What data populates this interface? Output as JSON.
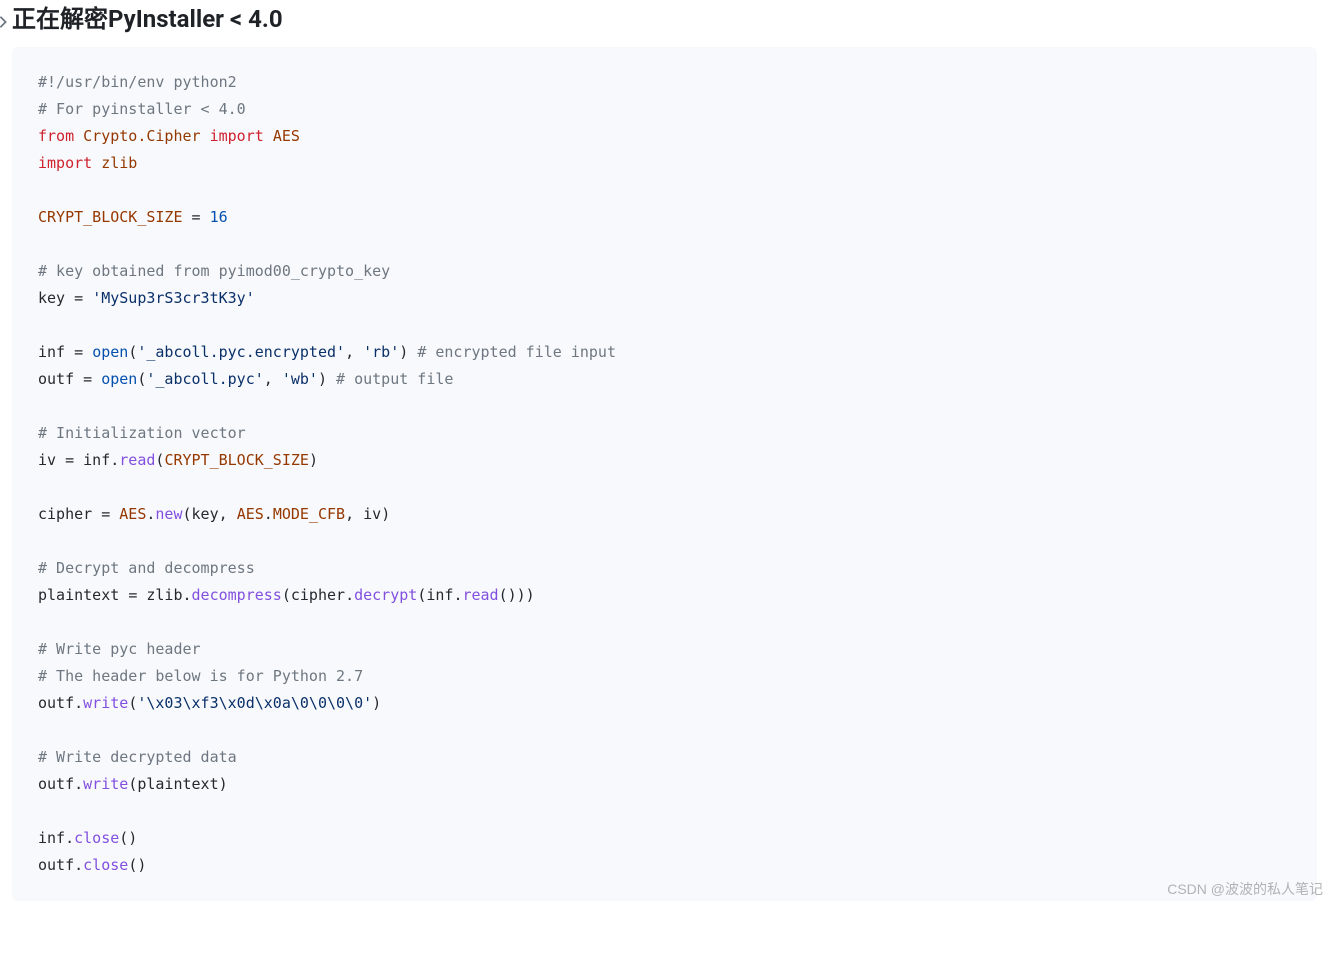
{
  "heading": "正在解密PyInstaller < 4.0",
  "watermark": "CSDN @波波的私人笔记",
  "code": {
    "l1": "#!/usr/bin/env python2",
    "l2": "# For pyinstaller < 4.0",
    "l3a": "from",
    "l3b": "Crypto.Cipher",
    "l3c": "import",
    "l3d": "AES",
    "l4a": "import",
    "l4b": "zlib",
    "l6a": "CRYPT_BLOCK_SIZE",
    "l6b": "=",
    "l6c": "16",
    "l8": "# key obtained from pyimod00_crypto_key",
    "l9a": "key",
    "l9b": "=",
    "l9c": "'MySup3rS3cr3tK3y'",
    "l11a": "inf",
    "l11b": "=",
    "l11c": "open",
    "l11d": "(",
    "l11e": "'_abcoll.pyc.encrypted'",
    "l11f": ",",
    "l11g": "'rb'",
    "l11h": ")",
    "l11i": "# encrypted file input",
    "l12a": "outf",
    "l12b": "=",
    "l12c": "open",
    "l12d": "(",
    "l12e": "'_abcoll.pyc'",
    "l12f": ",",
    "l12g": "'wb'",
    "l12h": ")",
    "l12i": "# output file",
    "l14": "# Initialization vector",
    "l15a": "iv",
    "l15b": "=",
    "l15c": "inf",
    "l15d": ".",
    "l15e": "read",
    "l15f": "(",
    "l15g": "CRYPT_BLOCK_SIZE",
    "l15h": ")",
    "l17a": "cipher",
    "l17b": "=",
    "l17c": "AES",
    "l17d": ".",
    "l17e": "new",
    "l17f": "(",
    "l17g": "key",
    "l17h": ",",
    "l17i": "AES",
    "l17j": ".",
    "l17k": "MODE_CFB",
    "l17l": ",",
    "l17m": "iv",
    "l17n": ")",
    "l19": "# Decrypt and decompress",
    "l20a": "plaintext",
    "l20b": "=",
    "l20c": "zlib",
    "l20d": ".",
    "l20e": "decompress",
    "l20f": "(",
    "l20g": "cipher",
    "l20h": ".",
    "l20i": "decrypt",
    "l20j": "(",
    "l20k": "inf",
    "l20l": ".",
    "l20m": "read",
    "l20n": "()))",
    "l22": "# Write pyc header",
    "l23": "# The header below is for Python 2.7",
    "l24a": "outf",
    "l24b": ".",
    "l24c": "write",
    "l24d": "(",
    "l24e": "'\\x03\\xf3\\x0d\\x0a\\0\\0\\0\\0'",
    "l24f": ")",
    "l26": "# Write decrypted data",
    "l27a": "outf",
    "l27b": ".",
    "l27c": "write",
    "l27d": "(",
    "l27e": "plaintext",
    "l27f": ")",
    "l29a": "inf",
    "l29b": ".",
    "l29c": "close",
    "l29d": "()",
    "l30a": "outf",
    "l30b": ".",
    "l30c": "close",
    "l30d": "()"
  }
}
